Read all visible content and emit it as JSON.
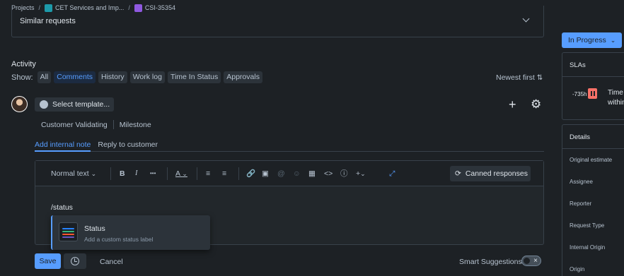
{
  "breadcrumb": {
    "items": [
      "Projects",
      "CET Services and Imp...",
      "CSI-35354"
    ],
    "separator": "/"
  },
  "similar": {
    "label": "Similar requests"
  },
  "activity": {
    "title": "Activity",
    "show_label": "Show:",
    "filters": [
      "All",
      "Comments",
      "History",
      "Work log",
      "Time In Status",
      "Approvals"
    ],
    "active_filter": "Comments",
    "sort_label": "Newest first"
  },
  "composer": {
    "template_label": "Select template...",
    "quick_links": [
      "Customer Validating",
      "Milestone"
    ],
    "tabs": [
      "Add internal note",
      "Reply to customer"
    ],
    "active_tab": "Add internal note",
    "toolbar": {
      "text_style": "Normal text",
      "bold": "B",
      "italic": "I",
      "more": "•••",
      "text_color": "A",
      "canned_label": "Canned responses"
    },
    "content": "/status",
    "suggestion": {
      "title": "Status",
      "description": "Add a custom status label",
      "icon_colors": [
        "#2684ff",
        "#36b37e",
        "#ff5630",
        "#6554c0"
      ]
    },
    "save_label": "Save",
    "cancel_label": "Cancel",
    "smart_label": "Smart Suggestions"
  },
  "side": {
    "status_label": "In Progress",
    "sla_title": "SLAs",
    "sla_time": "-735h",
    "sla_text": "Time\nwithin",
    "details_title": "Details",
    "fields": [
      "Original estimate",
      "Assignee",
      "Reporter",
      "Request Type",
      "Internal Origin",
      "Origin"
    ]
  },
  "colors": {
    "accent": "#579dff",
    "background": "#1d2125",
    "danger": "#f87168"
  }
}
